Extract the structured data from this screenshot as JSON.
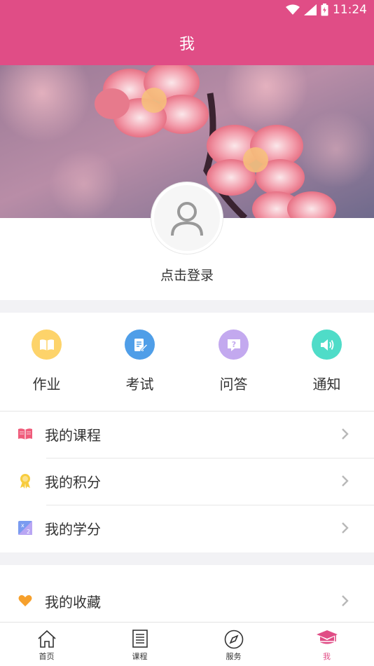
{
  "status_bar": {
    "time": "11:24"
  },
  "header": {
    "title": "我"
  },
  "profile": {
    "login_label": "点击登录"
  },
  "quick_actions": [
    {
      "label": "作业",
      "icon": "book-open-icon",
      "color": "#fdd36a"
    },
    {
      "label": "考试",
      "icon": "exam-edit-icon",
      "color": "#4f9ee8"
    },
    {
      "label": "问答",
      "icon": "question-icon",
      "color": "#c3a9ef"
    },
    {
      "label": "通知",
      "icon": "speaker-icon",
      "color": "#4fdcc8"
    }
  ],
  "menu_group_1": [
    {
      "label": "我的课程",
      "icon": "course-book-icon",
      "color": "#ef5b7a"
    },
    {
      "label": "我的积分",
      "icon": "medal-icon",
      "color": "#f7cc3e"
    },
    {
      "label": "我的学分",
      "icon": "credit-icon",
      "color": "#7a9bf0"
    }
  ],
  "menu_group_2": [
    {
      "label": "我的收藏",
      "icon": "heart-icon",
      "color": "#f6a02c"
    }
  ],
  "tabbar": [
    {
      "label": "首页",
      "icon": "home-icon",
      "active": false
    },
    {
      "label": "课程",
      "icon": "list-icon",
      "active": false
    },
    {
      "label": "服务",
      "icon": "compass-icon",
      "active": false
    },
    {
      "label": "我",
      "icon": "graduation-cap-icon",
      "active": true
    }
  ],
  "colors": {
    "brand": "#e04d86",
    "active_tab": "#e04d86"
  }
}
